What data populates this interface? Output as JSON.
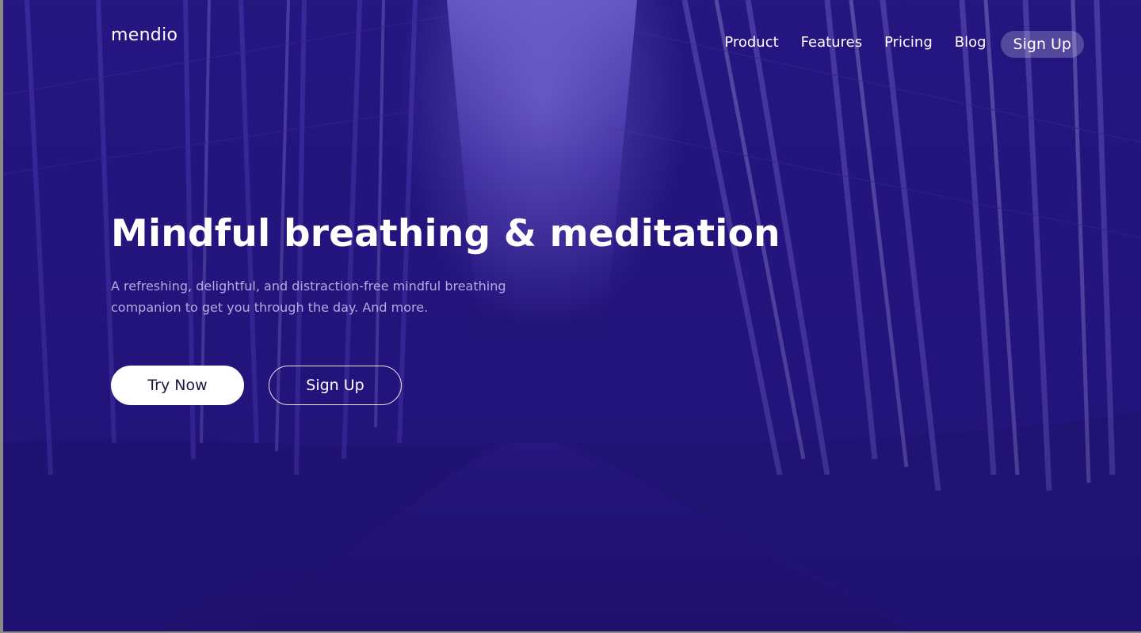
{
  "brand": {
    "logo_text": "mendio"
  },
  "nav": {
    "links": [
      {
        "label": "Product"
      },
      {
        "label": "Features"
      },
      {
        "label": "Pricing"
      },
      {
        "label": "Blog"
      }
    ],
    "signup_label": "Sign Up"
  },
  "hero": {
    "title": "Mindful breathing & meditation",
    "subtitle": "A refreshing, delightful, and distraction-free mindful breathing companion to get you through the day. And more.",
    "primary_cta": "Try Now",
    "secondary_cta": "Sign Up"
  },
  "colors": {
    "overlay": "#241578",
    "text": "#ffffff"
  }
}
